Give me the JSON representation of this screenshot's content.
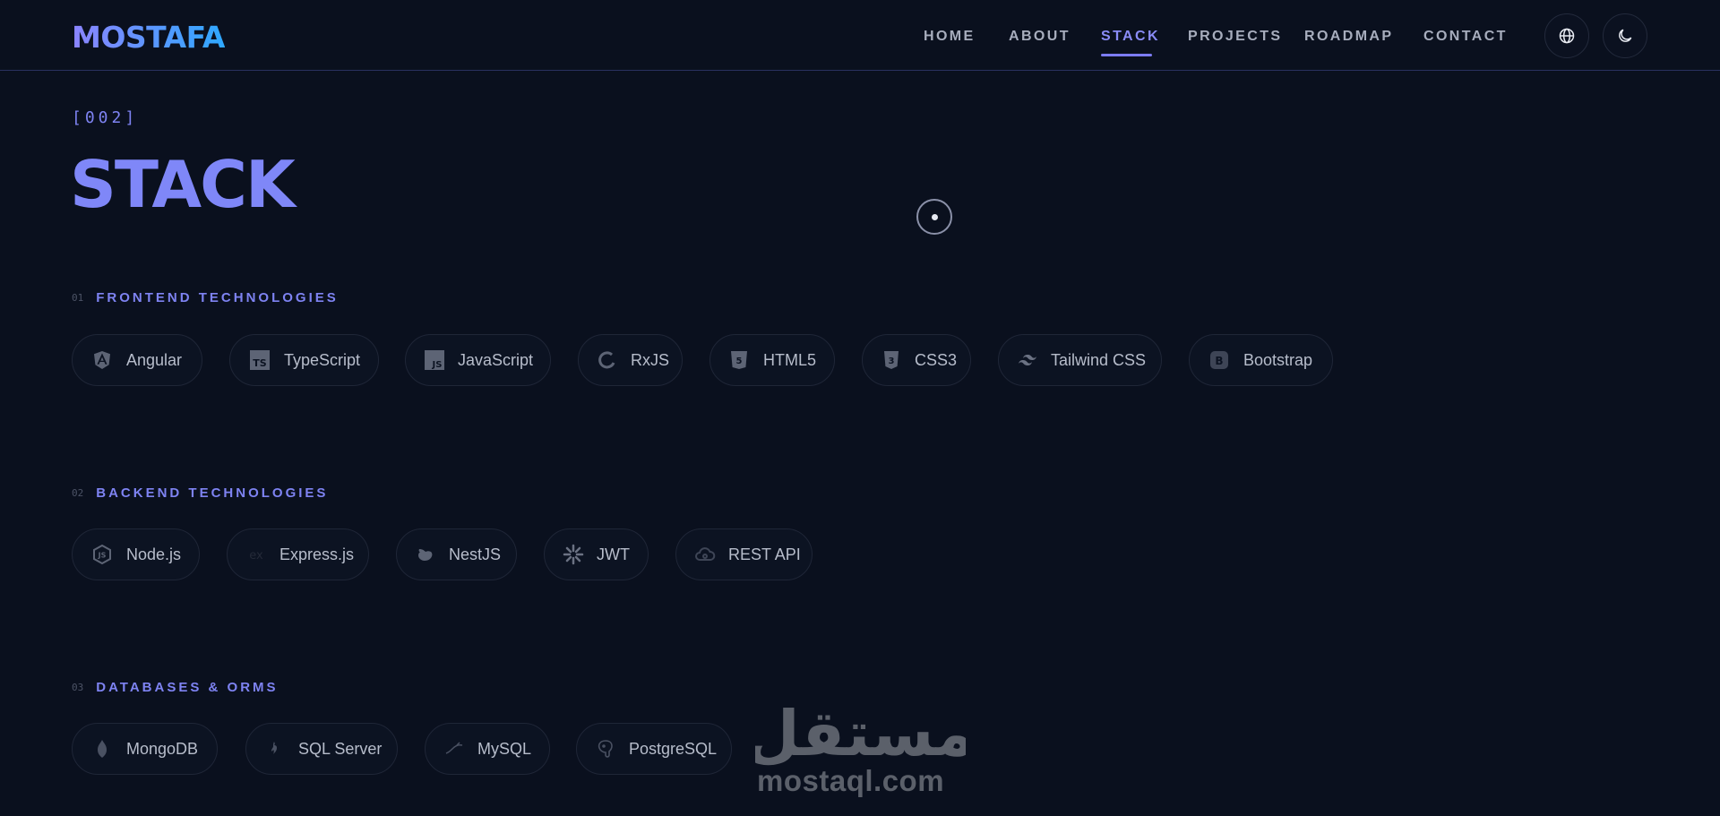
{
  "brand": {
    "logo": "MOSTAFA"
  },
  "nav": {
    "items": [
      {
        "label": "HOME"
      },
      {
        "label": "ABOUT"
      },
      {
        "label": "STACK"
      },
      {
        "label": "PROJECTS"
      },
      {
        "label": "ROADMAP"
      },
      {
        "label": "CONTACT"
      }
    ],
    "active": "STACK",
    "language_icon": "globe-icon",
    "theme_icon": "moon-icon"
  },
  "section": {
    "index": "[002]",
    "title": "STACK"
  },
  "categories": [
    {
      "num": "01",
      "title": "FRONTEND TECHNOLOGIES",
      "items": [
        {
          "label": "Angular",
          "icon": "angular-icon"
        },
        {
          "label": "TypeScript",
          "icon": "typescript-icon"
        },
        {
          "label": "JavaScript",
          "icon": "javascript-icon"
        },
        {
          "label": "RxJS",
          "icon": "rxjs-icon"
        },
        {
          "label": "HTML5",
          "icon": "html5-icon"
        },
        {
          "label": "CSS3",
          "icon": "css3-icon"
        },
        {
          "label": "Tailwind CSS",
          "icon": "tailwind-icon"
        },
        {
          "label": "Bootstrap",
          "icon": "bootstrap-icon"
        }
      ]
    },
    {
      "num": "02",
      "title": "BACKEND TECHNOLOGIES",
      "items": [
        {
          "label": "Node.js",
          "icon": "nodejs-icon"
        },
        {
          "label": "Express.js",
          "icon": "express-icon"
        },
        {
          "label": "NestJS",
          "icon": "nestjs-icon"
        },
        {
          "label": "JWT",
          "icon": "jwt-icon"
        },
        {
          "label": "REST API",
          "icon": "rest-api-icon"
        }
      ]
    },
    {
      "num": "03",
      "title": "DATABASES & ORMS",
      "items": [
        {
          "label": "MongoDB",
          "icon": "mongodb-icon"
        },
        {
          "label": "SQL Server",
          "icon": "sql-server-icon"
        },
        {
          "label": "MySQL",
          "icon": "mysql-icon"
        },
        {
          "label": "PostgreSQL",
          "icon": "postgresql-icon"
        }
      ]
    }
  ],
  "watermark": {
    "arabic": "مستقل",
    "latin": "mostaql.com"
  },
  "colors": {
    "background": "#0a101e",
    "accent": "#7f87f8",
    "logo_gradient_start": "#8c84ff",
    "logo_gradient_end": "#2ea8ff",
    "chip_border": "#1f2637"
  }
}
